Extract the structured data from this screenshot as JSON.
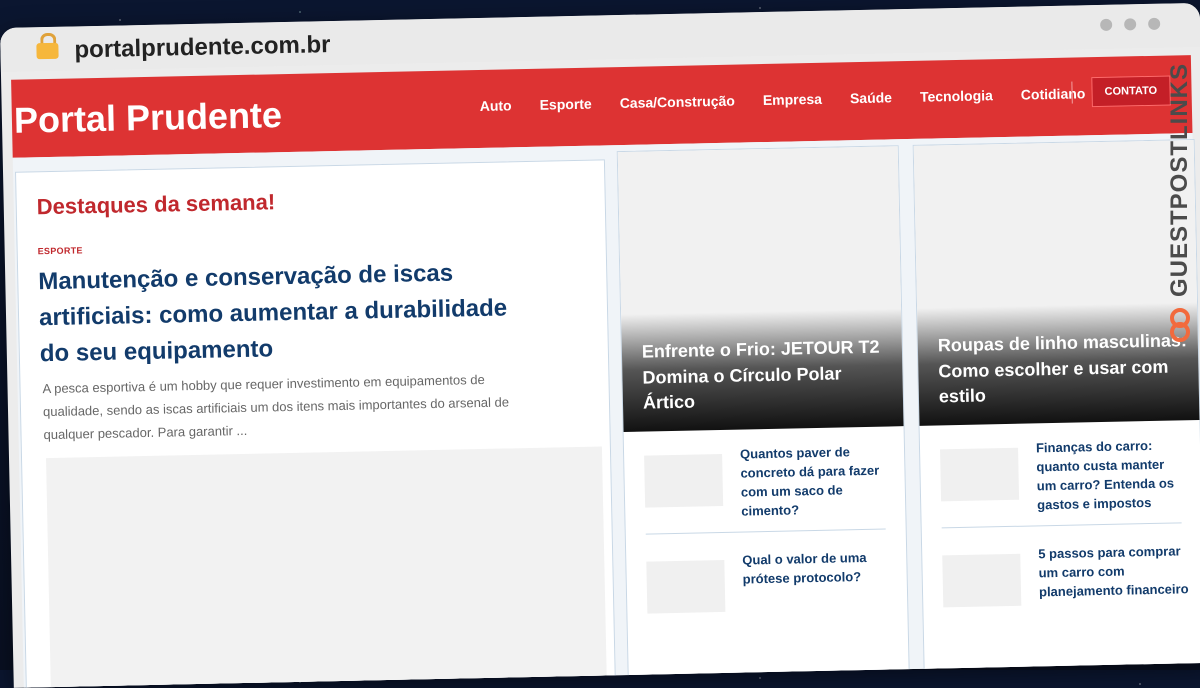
{
  "browser": {
    "url": "portalprudente.com.br"
  },
  "site": {
    "logo": "Portal Prudente",
    "menu": [
      "Auto",
      "Esporte",
      "Casa/Construção",
      "Empresa",
      "Saúde",
      "Tecnologia",
      "Cotidiano"
    ],
    "contact_button": "CONTATO"
  },
  "featured": {
    "heading": "Destaques da semana!",
    "category": "ESPORTE",
    "title": "Manutenção e conservação de iscas artificiais: como aumentar a durabilidade do seu equipamento",
    "excerpt": "A pesca esportiva é um hobby que requer investimento em equipamentos de qualidade, sendo as iscas artificiais um dos itens mais importantes do arsenal de qualquer pescador. Para garantir ..."
  },
  "column1": {
    "hero_title": "Enfrente o Frio: JETOUR T2 Domina o Círculo Polar Ártico",
    "items": [
      "Quantos paver de concreto dá para fazer com um saco de cimento?",
      "Qual o valor de uma prótese protocolo?"
    ]
  },
  "column2": {
    "hero_title": "Roupas de linho masculinas: Como escolher e usar com estilo",
    "items": [
      "Finanças do carro: quanto custa manter um carro? Entenda os gastos e impostos",
      "5 passos para comprar um carro com planejamento financeiro"
    ]
  },
  "watermark": {
    "text": "GUESTPOSTLINKS"
  },
  "colors": {
    "brand_red": "#dd3333",
    "title_blue": "#123b6b",
    "accent_red": "#c0282d"
  }
}
